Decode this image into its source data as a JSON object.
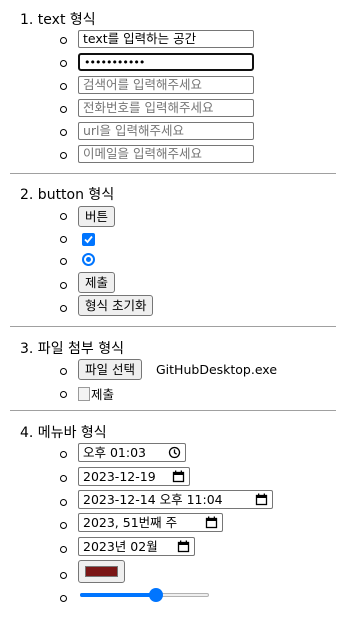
{
  "text_section": {
    "title": "1. text 형식",
    "text_value": "text를 입력하는 공간",
    "password_dots": "•••••••••••",
    "search_placeholder": "검색어를 입력해주세요",
    "tel_placeholder": "전화번호를 입력해주세요",
    "url_placeholder": "url을 입력해주세요",
    "email_placeholder": "이메일을 입력해주세요"
  },
  "button_section": {
    "title": "2. button 형식",
    "button_label": "버튼",
    "checkbox_checked": true,
    "radio_checked": true,
    "submit_label": "제출",
    "reset_label": "형식 초기화"
  },
  "file_section": {
    "title": "3. 파일 첨부 형식",
    "choose_file_label": "파일 선택",
    "file_name": "GitHubDesktop.exe",
    "image_alt": "제출"
  },
  "menu_section": {
    "title": "4. 메뉴바 형식",
    "time_value": "오후 01:03",
    "date_value": "2023-12-19",
    "datetime_value": "2023-12-14 오후 11:04",
    "week_value": "2023, 51번째 주",
    "month_value": "2023년 02월",
    "color_value": "#7b1616",
    "range_value_percent": 60
  },
  "colors": {
    "accent": "#0075ff",
    "button_bg": "#efefef",
    "border": "#767676"
  }
}
